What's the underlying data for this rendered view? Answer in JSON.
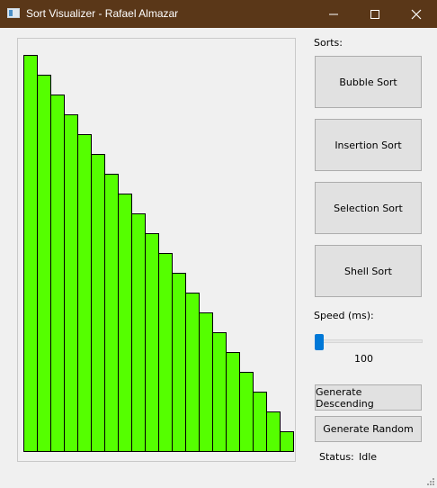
{
  "window": {
    "title": "Sort Visualizer - Rafael Almazar"
  },
  "sorts": {
    "label": "Sorts:",
    "buttons": [
      "Bubble Sort",
      "Insertion Sort",
      "Selection Sort",
      "Shell Sort"
    ]
  },
  "speed": {
    "label": "Speed (ms):",
    "value": "100",
    "slider_fraction": 0
  },
  "generate": {
    "descending_label": "Generate Descending",
    "random_label": "Generate Random"
  },
  "status": {
    "label": "Status:",
    "value": "Idle"
  },
  "colors": {
    "bar_fill": "#55ff00",
    "bar_stroke": "#000000",
    "titlebar": "#5a3718",
    "slider_thumb": "#0078d7"
  },
  "chart_data": {
    "type": "bar",
    "values": [
      20,
      19,
      18,
      17,
      16,
      15,
      14,
      13,
      12,
      11,
      10,
      9,
      8,
      7,
      6,
      5,
      4,
      3,
      2,
      1
    ],
    "ylim": [
      0,
      20
    ]
  }
}
